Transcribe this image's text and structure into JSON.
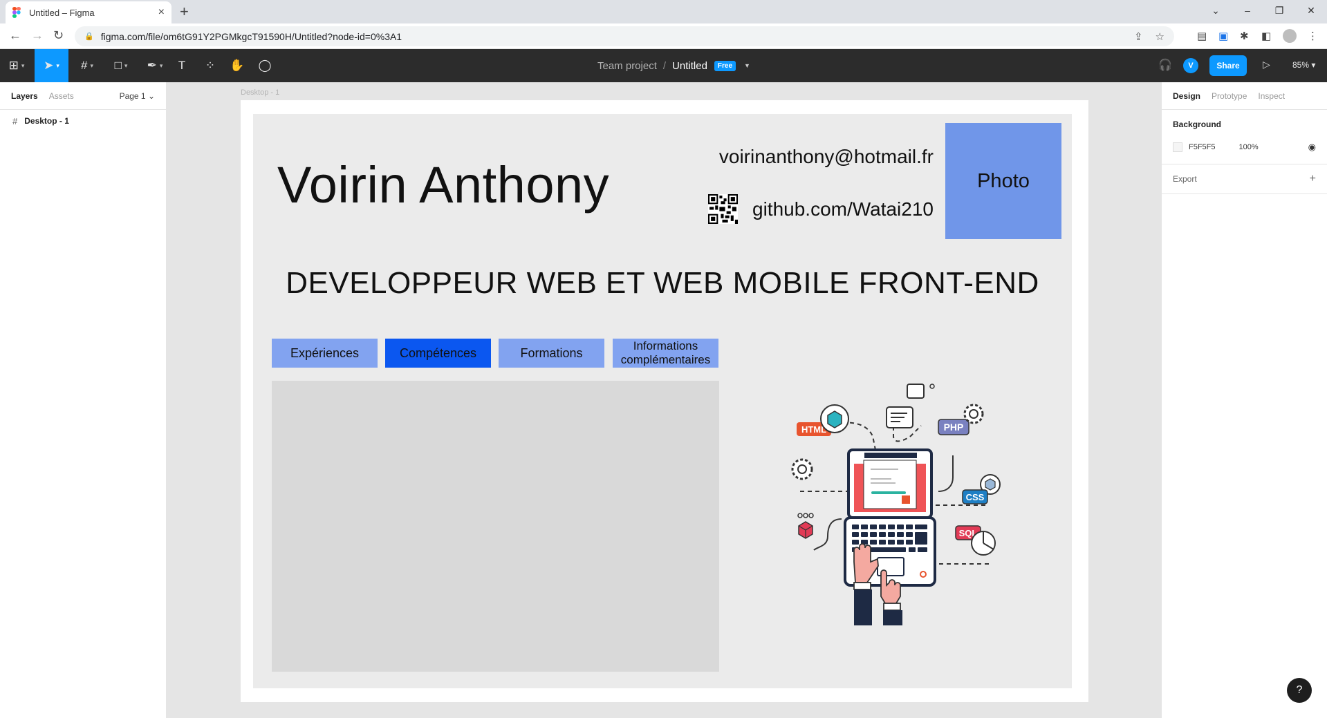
{
  "browser": {
    "tab_title": "Untitled – Figma",
    "new_tab": "+",
    "url": "figma.com/file/om6tG91Y2PGMkgcT91590H/Untitled?node-id=0%3A1"
  },
  "toolbar": {
    "project": "Team project",
    "separator": "/",
    "file_name": "Untitled",
    "plan_badge": "Free",
    "avatar_initial": "V",
    "share_label": "Share",
    "zoom": "85%"
  },
  "left_panel": {
    "tabs": [
      "Layers",
      "Assets"
    ],
    "page_selector": "Page 1",
    "layers": [
      {
        "label": "Desktop - 1"
      }
    ]
  },
  "canvas": {
    "frame_label": "Desktop - 1",
    "cv": {
      "name": "Voirin Anthony",
      "email": "voirinanthony@hotmail.fr",
      "github": "github.com/Watai210",
      "photo_label": "Photo",
      "job_title": "DEVELOPPEUR WEB ET WEB MOBILE FRONT-END",
      "tabs": [
        {
          "label": "Expériences",
          "selected": false
        },
        {
          "label": "Compétences",
          "selected": true
        },
        {
          "label": "Formations",
          "selected": false
        },
        {
          "label": "Informations complémentaires",
          "selected": false
        }
      ],
      "illustration_tags": [
        "HTML",
        "PHP",
        "CSS",
        "SQL"
      ],
      "colors": {
        "photo": "#7096e9",
        "tab": "#82a3f0",
        "tab_selected": "#0b57f0",
        "content_box": "#d9d9d9"
      }
    }
  },
  "right_panel": {
    "tabs": [
      "Design",
      "Prototype",
      "Inspect"
    ],
    "background_heading": "Background",
    "background_hex": "F5F5F5",
    "background_opacity": "100%",
    "export_label": "Export"
  },
  "help": "?"
}
